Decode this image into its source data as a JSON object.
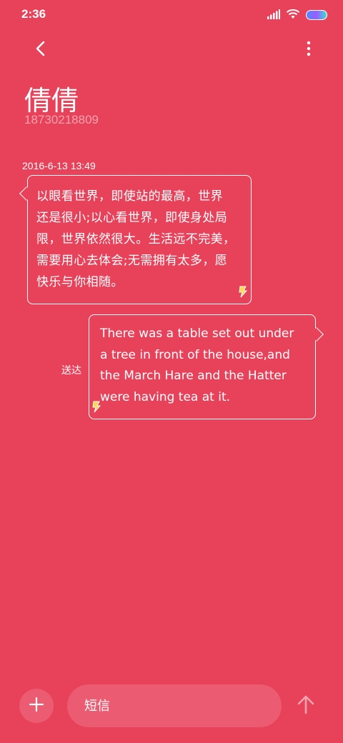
{
  "status_bar": {
    "time": "2:36",
    "icons": [
      "signal-icon",
      "wifi-icon",
      "battery-icon"
    ]
  },
  "header": {
    "back_icon": "chevron-left-icon",
    "more_icon": "more-vertical-icon"
  },
  "contact": {
    "name": "倩倩",
    "number": "18730218809"
  },
  "conversation": {
    "timestamp": "2016-6-13 13:49",
    "messages": [
      {
        "direction": "received",
        "lines": [
          "以眼看世界，即使站的最高，世界",
          "还是很小;以心看世界，即使身处局",
          "限，世界依然很大。生活远不完美，",
          "需要用心去体会;无需拥有太多，愿",
          "快乐与你相随。"
        ]
      },
      {
        "direction": "sent",
        "status": "送达",
        "lines": [
          "There was a table set out under",
          "a tree in front of the house,and",
          "the March Hare and the Hatter",
          "were having tea at it."
        ]
      }
    ]
  },
  "composer": {
    "placeholder": "短信",
    "add_icon": "plus-icon",
    "send_icon": "arrow-up-icon"
  },
  "colors": {
    "background": "#e8415a",
    "text": "#ffffff",
    "number_text": "#f4a3ae",
    "flash_icon": "#ffd84a"
  }
}
